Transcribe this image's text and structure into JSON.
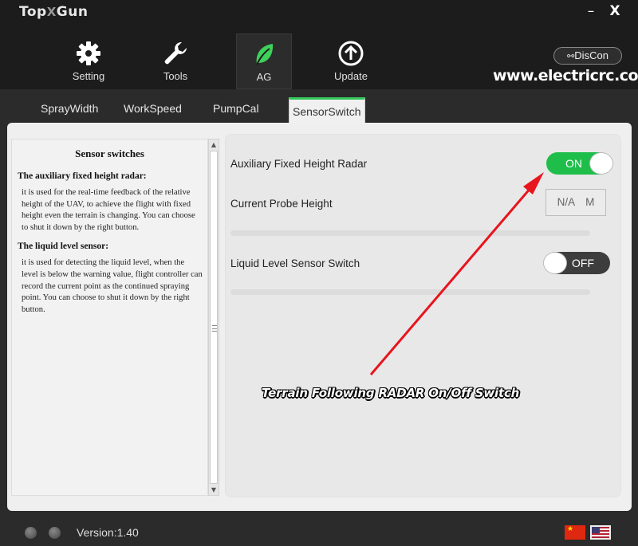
{
  "app": {
    "logo_left": "Top",
    "logo_mid": "X",
    "logo_right": "Gun",
    "minimize_label": "–",
    "close_label": "X"
  },
  "nav": {
    "setting": "Setting",
    "tools": "Tools",
    "ag": "AG",
    "update": "Update"
  },
  "discon_label": "DisCon",
  "watermark": "www.electricrc.co.kr",
  "tabs": [
    "SprayWidth",
    "WorkSpeed",
    "PumpCal",
    "SensorSwitch"
  ],
  "active_tab": "SensorSwitch",
  "help": {
    "title": "Sensor switches",
    "section1_heading": "The auxiliary fixed height radar:",
    "section1_text": "it is used for the real-time feedback of the relative height of the UAV, to achieve the flight with fixed height even the terrain is changing. You can choose to shut it down by the right button.",
    "section2_heading": "The liquid level sensor:",
    "section2_text": "it is used for detecting the liquid level, when the level is below the warning value, flight controller can record the current point as the continued spraying point. You can choose to shut it down by the right button."
  },
  "settings": {
    "radar_label": "Auxiliary Fixed Height Radar",
    "radar_state": "ON",
    "probe_label": "Current Probe Height",
    "probe_value": "N/A M",
    "liquid_label": "Liquid Level Sensor Switch",
    "liquid_state": "OFF"
  },
  "annotation": "Terrain Following RADAR On/Off Switch",
  "version": "Version:1.40",
  "colors": {
    "accent_green": "#1fbe4a",
    "annotation_arrow": "#e8141e"
  }
}
